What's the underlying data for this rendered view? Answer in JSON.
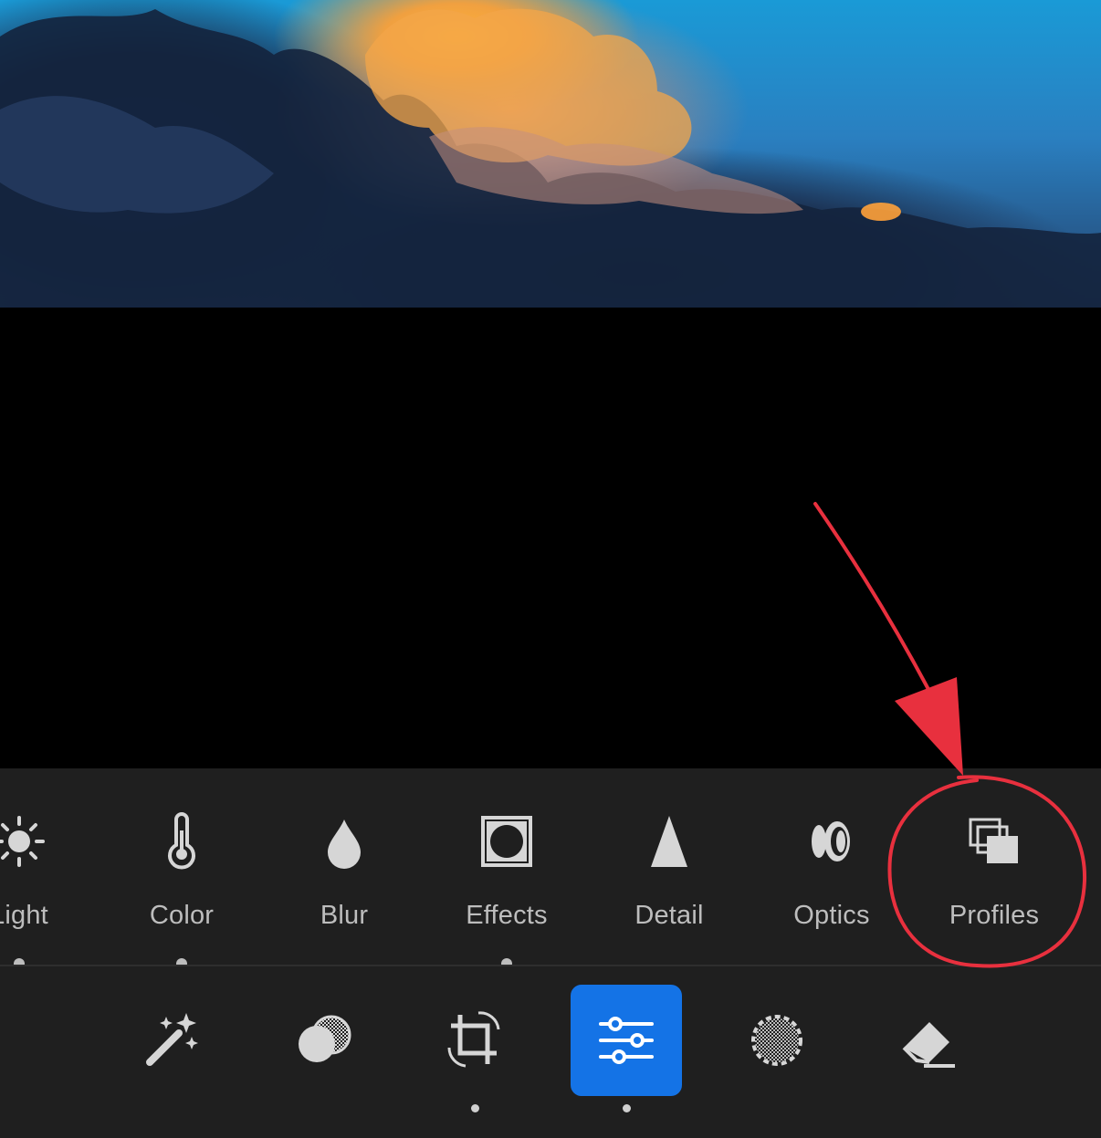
{
  "colors": {
    "panel_bg": "#1f1f1f",
    "label": "#bdbdbd",
    "accent_blue": "#1473e6",
    "annotation_red": "#e8303e"
  },
  "edit_panels": [
    {
      "label": "Light",
      "icon": "sun-icon",
      "has_dot": true
    },
    {
      "label": "Color",
      "icon": "thermometer-icon",
      "has_dot": true
    },
    {
      "label": "Blur",
      "icon": "droplet-icon",
      "has_dot": false
    },
    {
      "label": "Effects",
      "icon": "vignette-frame-icon",
      "has_dot": true
    },
    {
      "label": "Detail",
      "icon": "triangle-icon",
      "has_dot": false
    },
    {
      "label": "Optics",
      "icon": "lens-icon",
      "has_dot": false
    },
    {
      "label": "Profiles",
      "icon": "stacked-layers-icon",
      "has_dot": false
    }
  ],
  "bottom_toolbar": [
    {
      "icon": "magic-wand-icon",
      "active": false,
      "has_dot": false
    },
    {
      "icon": "overlapping-circles-icon",
      "active": false,
      "has_dot": false
    },
    {
      "icon": "crop-rotate-icon",
      "active": false,
      "has_dot": true
    },
    {
      "icon": "sliders-icon",
      "active": true,
      "has_dot": true
    },
    {
      "icon": "dotted-circle-mask-icon",
      "active": false,
      "has_dot": false
    },
    {
      "icon": "eraser-icon",
      "active": false,
      "has_dot": false
    }
  ]
}
